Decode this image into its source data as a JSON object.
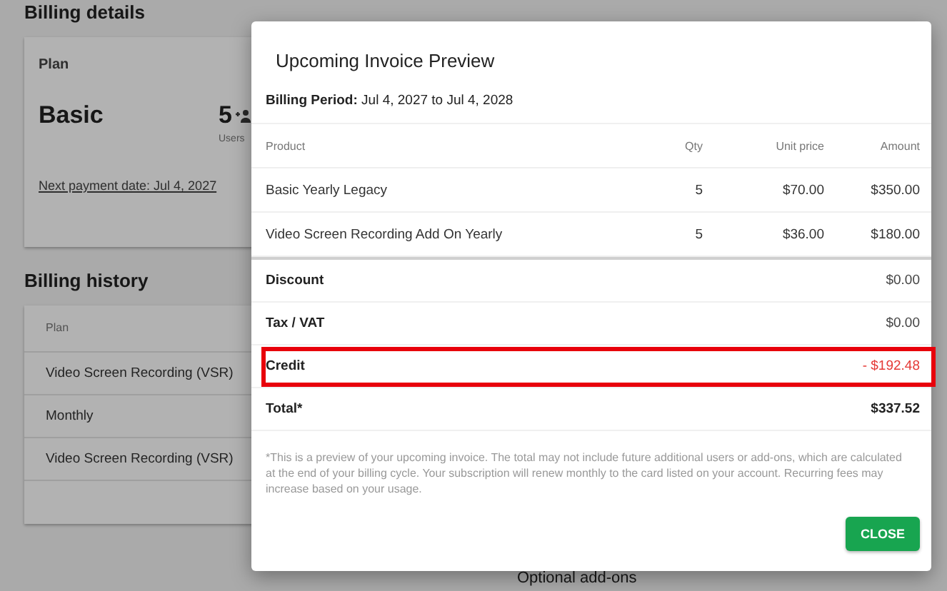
{
  "page": {
    "section_title": "Billing details",
    "plan_card": {
      "label": "Plan",
      "plan_name": "Basic",
      "users_count": "5",
      "users_label": "Users",
      "next_payment": "Next payment date: Jul 4, 2027"
    },
    "history_title": "Billing history",
    "history_table": {
      "columns": [
        "Plan"
      ],
      "rows": [
        "Video Screen Recording (VSR)",
        "Monthly",
        "Video Screen Recording (VSR)"
      ]
    },
    "addons_title": "Optional add-ons"
  },
  "dialog": {
    "title": "Upcoming Invoice Preview",
    "billing_period": "**Billing Period:** Jul 4, 2027 to Jul 4, 2028",
    "columns": [
      "Product",
      "Qty",
      "Unit price",
      "Amount"
    ],
    "rows": [
      {
        "product": "Basic Yearly Legacy",
        "qty": "5",
        "unit_price": "$70.00",
        "amount": "$350.00"
      },
      {
        "product": "Video Screen Recording Add On Yearly",
        "qty": "5",
        "unit_price": "$36.00",
        "amount": "$180.00"
      }
    ],
    "summary": [
      {
        "label": "Discount",
        "value": "$0.00",
        "kind": "plain",
        "highlighted": false
      },
      {
        "label": "Tax / VAT",
        "value": "$0.00",
        "kind": "plain",
        "highlighted": false
      },
      {
        "label": "Credit",
        "value": "- $192.48",
        "kind": "credit",
        "highlighted": true
      },
      {
        "label": "Total*",
        "value": "$337.52",
        "kind": "total",
        "highlighted": false
      }
    ],
    "note": "*This is a preview of your upcoming invoice. The total may not include future additional users or add-ons, which are calculated at the end of your billing cycle. Your subscription will renew monthly to the card listed on your account. Recurring fees may increase based on your usage.",
    "close_button": "CLOSE"
  }
}
